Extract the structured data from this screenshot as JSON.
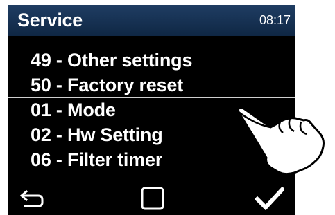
{
  "header": {
    "title": "Service",
    "time": "08:17"
  },
  "menu": {
    "items": [
      {
        "label": "49 - Other settings",
        "selected": false
      },
      {
        "label": "50 - Factory reset",
        "selected": false
      },
      {
        "label": "01 - Mode",
        "selected": true
      },
      {
        "label": "02 - Hw Setting",
        "selected": false
      },
      {
        "label": "06 - Filter timer",
        "selected": false
      }
    ]
  },
  "footer": {
    "buttons": [
      {
        "icon": "back-arrow-icon"
      },
      {
        "icon": "square-icon"
      },
      {
        "icon": "checkmark-icon"
      }
    ]
  },
  "overlay": {
    "icon": "pointing-hand-icon"
  },
  "colors": {
    "background": "#000000",
    "header": "#1a365a",
    "text": "#ffffff",
    "selection_line": "#cfcfcf"
  }
}
